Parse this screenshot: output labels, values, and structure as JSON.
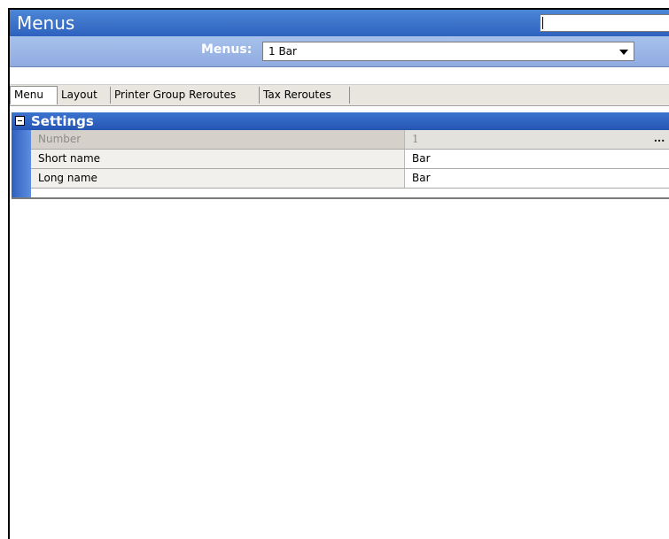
{
  "window": {
    "title": "Menus"
  },
  "selector": {
    "label": "Menus:",
    "value": "1 Bar"
  },
  "tabs": [
    {
      "label": "Menu",
      "active": true
    },
    {
      "label": "Layout",
      "active": false
    },
    {
      "label": "Printer Group Reroutes",
      "active": false
    },
    {
      "label": "Tax Reroutes",
      "active": false
    }
  ],
  "settings": {
    "group_title": "Settings",
    "rows": [
      {
        "name": "Number",
        "value": "1",
        "disabled": true,
        "ellipsis": "..."
      },
      {
        "name": "Short name",
        "value": "Bar",
        "disabled": false
      },
      {
        "name": "Long name",
        "value": "Bar",
        "disabled": false
      }
    ]
  },
  "colors": {
    "titlebar": "#2d62be",
    "selector_bar": "#a7c1ec",
    "group_header": "#2555b4"
  }
}
